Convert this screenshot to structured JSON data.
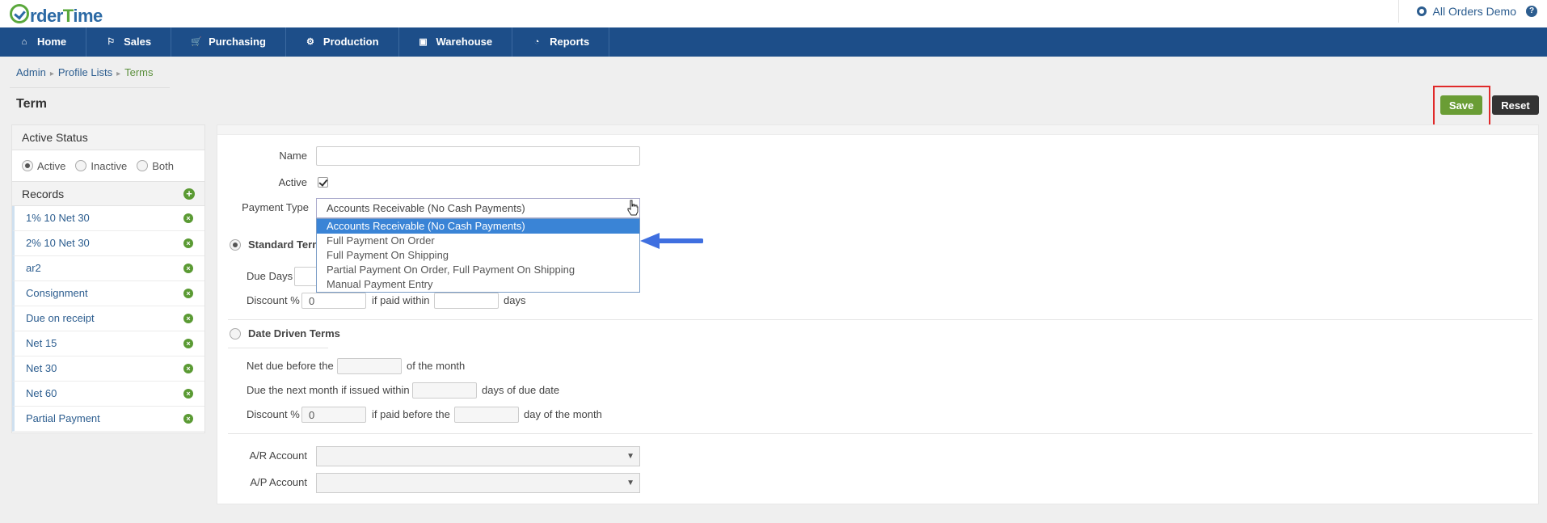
{
  "app": {
    "logo_pre": "rder",
    "logo_t": "T",
    "logo_post": "ime",
    "account": "All Orders Demo",
    "help": "?"
  },
  "nav": [
    {
      "label": "Home",
      "icon": "home-icon"
    },
    {
      "label": "Sales",
      "icon": "tag-icon"
    },
    {
      "label": "Purchasing",
      "icon": "cart-icon"
    },
    {
      "label": "Production",
      "icon": "gears-icon"
    },
    {
      "label": "Warehouse",
      "icon": "box-icon"
    },
    {
      "label": "Reports",
      "icon": "pie-chart-icon"
    }
  ],
  "breadcrumb": {
    "admin": "Admin",
    "profile_lists": "Profile Lists",
    "terms": "Terms"
  },
  "page_title": "Term",
  "buttons": {
    "save": "Save",
    "reset": "Reset"
  },
  "sidebar": {
    "active_status_title": "Active Status",
    "status_options": [
      "Active",
      "Inactive",
      "Both"
    ],
    "records_title": "Records",
    "records": [
      "1% 10 Net 30",
      "2% 10 Net 30",
      "ar2",
      "Consignment",
      "Due on receipt",
      "Net 15",
      "Net 30",
      "Net 60",
      "Partial Payment"
    ]
  },
  "form": {
    "name_label": "Name",
    "name_value": "",
    "active_label": "Active",
    "payment_type_label": "Payment Type",
    "payment_type_value": "Accounts Receivable (No Cash Payments)",
    "payment_options": [
      "Accounts Receivable (No Cash Payments)",
      "Full Payment On Order",
      "Full Payment On Shipping",
      "Partial Payment On Order, Full Payment On Shipping",
      "Manual Payment Entry"
    ],
    "standard_terms_label": "Standard Term",
    "due_days_label": "Due Days",
    "discount_label": "Discount %",
    "discount_value": "0",
    "if_paid_within": "if paid within",
    "days": "days",
    "date_driven_label": "Date Driven Terms",
    "net_due_before": "Net due before the",
    "of_the_month": "of the month",
    "due_next_month": "Due the next month if issued within",
    "days_of_due_date": "days of due date",
    "discount2_label": "Discount %",
    "discount2_value": "0",
    "if_paid_before": "if paid before the",
    "day_of_month": "day of the month",
    "ar_account_label": "A/R Account",
    "ap_account_label": "A/P Account"
  },
  "colors": {
    "nav": "#1d4e89",
    "save": "#6a9d35",
    "highlight": "#e02a2a",
    "selected_option": "#3a84d6",
    "arrow": "#3f6fe0"
  }
}
